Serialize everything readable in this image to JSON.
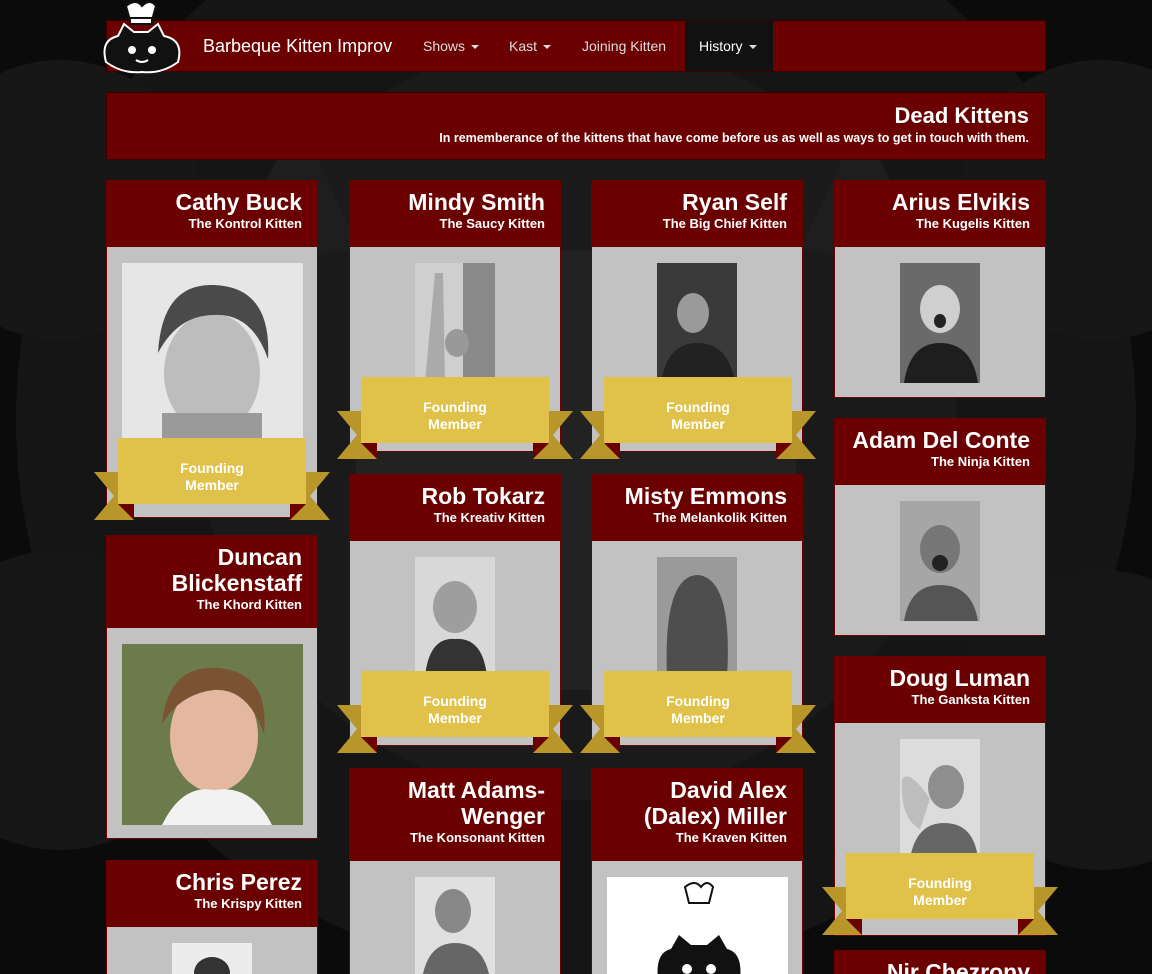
{
  "navbar": {
    "brand": "Barbeque Kitten Improv",
    "items": [
      {
        "label": "Shows",
        "dropdown": true
      },
      {
        "label": "Kast",
        "dropdown": true
      },
      {
        "label": "Joining Kitten",
        "dropdown": false
      },
      {
        "label": "History",
        "dropdown": true,
        "active": true
      }
    ]
  },
  "header": {
    "title": "Dead Kittens",
    "subtitle": "In rememberance of the kittens that have come before us as well as ways to get in touch with them."
  },
  "ribbon": {
    "line1": "Founding",
    "line2": "Member"
  },
  "members": [
    {
      "name": "Cathy Buck",
      "role": "The Kontrol Kitten",
      "founding": true
    },
    {
      "name": "Mindy Smith",
      "role": "The Saucy Kitten",
      "founding": true
    },
    {
      "name": "Ryan Self",
      "role": "The Big Chief Kitten",
      "founding": true
    },
    {
      "name": "Arius Elvikis",
      "role": "The Kugelis Kitten",
      "founding": false
    },
    {
      "name": "Adam Del Conte",
      "role": "The Ninja Kitten",
      "founding": false
    },
    {
      "name": "Duncan Blickenstaff",
      "role": "The Khord Kitten",
      "founding": false
    },
    {
      "name": "Rob Tokarz",
      "role": "The Kreativ Kitten",
      "founding": true
    },
    {
      "name": "Misty Emmons",
      "role": "The Melankolik Kitten",
      "founding": true
    },
    {
      "name": "Doug Luman",
      "role": "The Ganksta Kitten",
      "founding": true
    },
    {
      "name": "Matt Adams-Wenger",
      "role": "The Konsonant Kitten",
      "founding": false
    },
    {
      "name": "David Alex (Dalex) Miller",
      "role": "The Kraven Kitten",
      "founding": false
    },
    {
      "name": "Chris Perez",
      "role": "The Krispy Kitten",
      "founding": false
    },
    {
      "name": "Nir Chezrony",
      "role": "",
      "founding": false
    }
  ],
  "colors": {
    "card_header": "#6b0000",
    "card_body": "#c2c2c2",
    "ribbon": "#e0c14a",
    "ribbon_dark": "#b8962a"
  }
}
